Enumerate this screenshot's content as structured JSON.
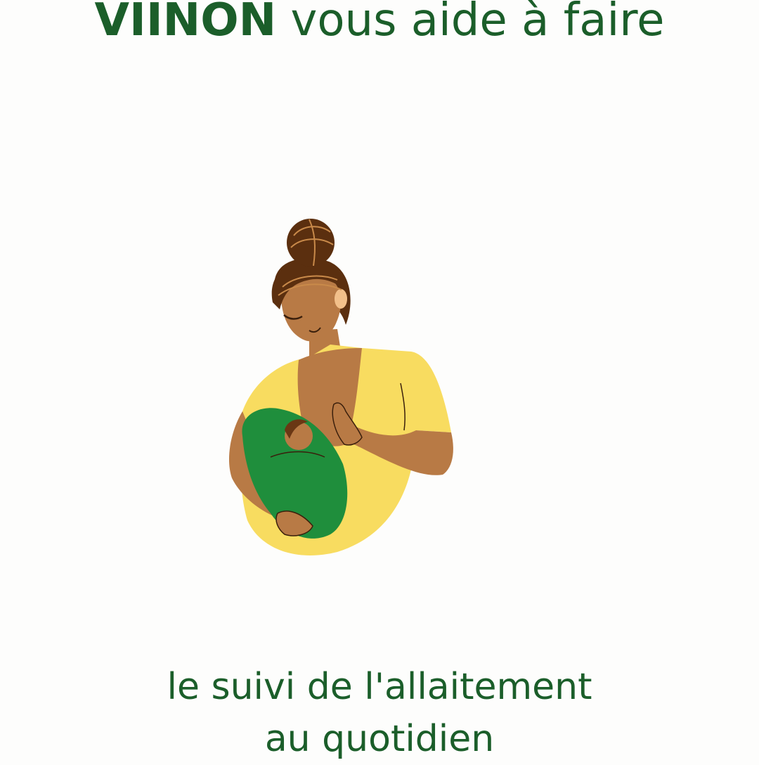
{
  "headline": {
    "brand": "VIINON",
    "rest": " vous aide à faire"
  },
  "illustration": {
    "icon": "breastfeeding-mother-illustration",
    "colors": {
      "skin": "#b87a45",
      "hair": "#5b2f0f",
      "hair_lines": "#c98a4a",
      "shirt": "#f8dc60",
      "blanket": "#1f8e3c",
      "baby_hair": "#6a3714"
    }
  },
  "caption": {
    "line1": "le suivi de l'allaitement",
    "line2": "au quotidien"
  },
  "colors": {
    "text": "#1b5e2a",
    "background": "#fdfdfc"
  }
}
